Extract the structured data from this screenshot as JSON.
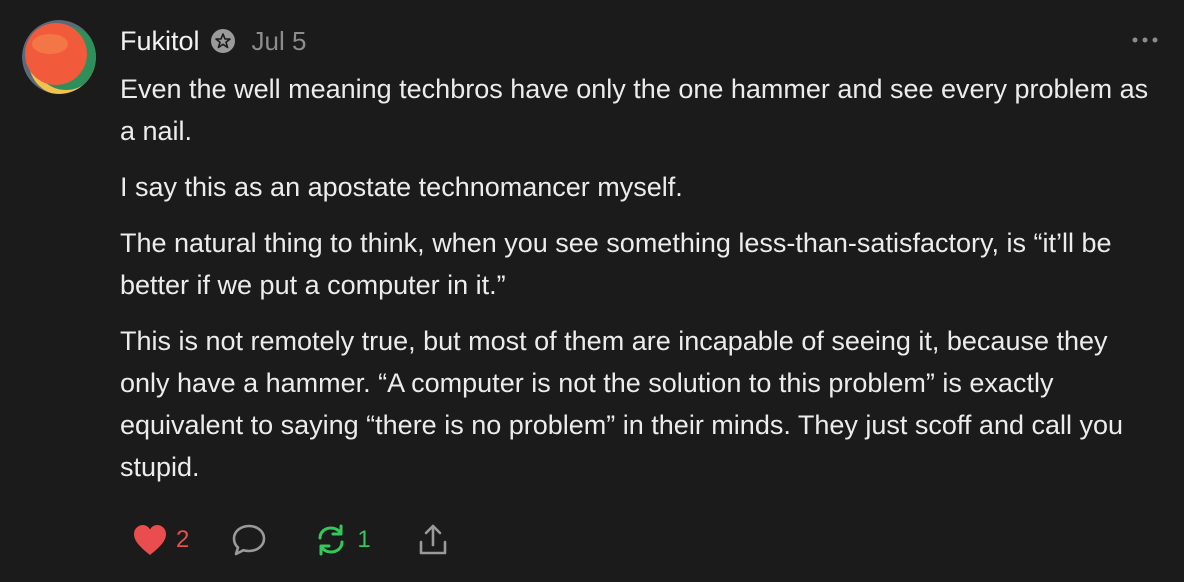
{
  "post": {
    "author": "Fukitol",
    "date": "Jul 5",
    "paragraphs": [
      "Even the well meaning techbros have only the one hammer and see every problem as a nail.",
      "I say this as an apostate technomancer myself.",
      "The natural thing to think, when you see something less-than-satisfactory, is “it’ll be better if we put a computer in it.”",
      "This is not remotely true, but most of them are incapable of seeing it, because they only have a hammer. “A computer is not the solution to this problem” is exactly equivalent to saying “there is no problem” in their minds. They just scoff and call you stupid."
    ]
  },
  "actions": {
    "likes": "2",
    "reposts": "1"
  },
  "icons": {
    "badge": "founding-member-badge-icon",
    "more": "more-options-icon",
    "like": "heart-icon",
    "reply": "comment-bubble-icon",
    "repost": "repost-icon",
    "share": "share-icon"
  },
  "colors": {
    "background": "#1b1b1b",
    "text": "#ececec",
    "muted": "#8c8c8c",
    "like": "#ea4d4d",
    "repost": "#34c759"
  }
}
